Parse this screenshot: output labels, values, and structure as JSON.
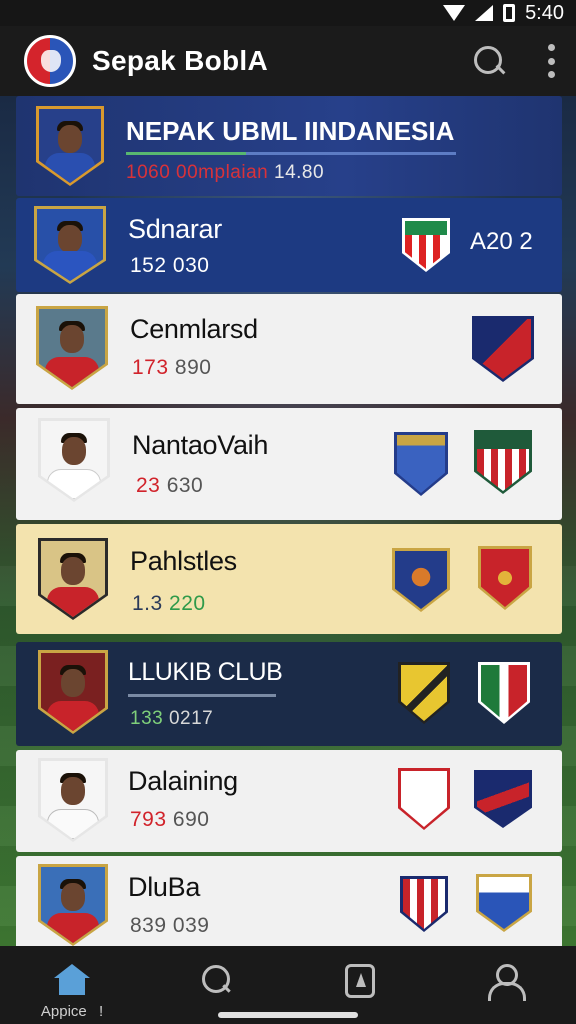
{
  "status": {
    "time": "5:40"
  },
  "app": {
    "title": "Sepak BoblA"
  },
  "rows": [
    {
      "name": "NEPAK UBML IINDANESIA",
      "stats_a": "1060 00mplaian",
      "stats_b": "14.80",
      "right_text": ""
    },
    {
      "name": "Sdnarar",
      "stats_a": "152",
      "stats_b": "030",
      "right_text": "A20 2"
    },
    {
      "name": "Cenmlarsd",
      "stats_a": "173",
      "stats_b": "890",
      "right_text": ""
    },
    {
      "name": "NantaoVaih",
      "stats_a": "23",
      "stats_b": "630",
      "right_text": ""
    },
    {
      "name": "Pahlstles",
      "stats_a": "1.3",
      "stats_b": "220",
      "right_text": ""
    },
    {
      "name": "LLUKIB CLUB",
      "stats_a": "133",
      "stats_b": "0217",
      "right_text": ""
    },
    {
      "name": "Dalaining",
      "stats_a": "793",
      "stats_b": "690",
      "right_text": ""
    },
    {
      "name": "DluBa",
      "stats_a": "839",
      "stats_b": "039",
      "right_text": ""
    }
  ],
  "nav": {
    "home_label": "Appice",
    "badge": "!"
  },
  "colors": {
    "accent": "#5aa0d8",
    "highlight_row": "#f3e3ae",
    "blue_row": "#1d3a82",
    "navy_row": "#1b2b48"
  }
}
